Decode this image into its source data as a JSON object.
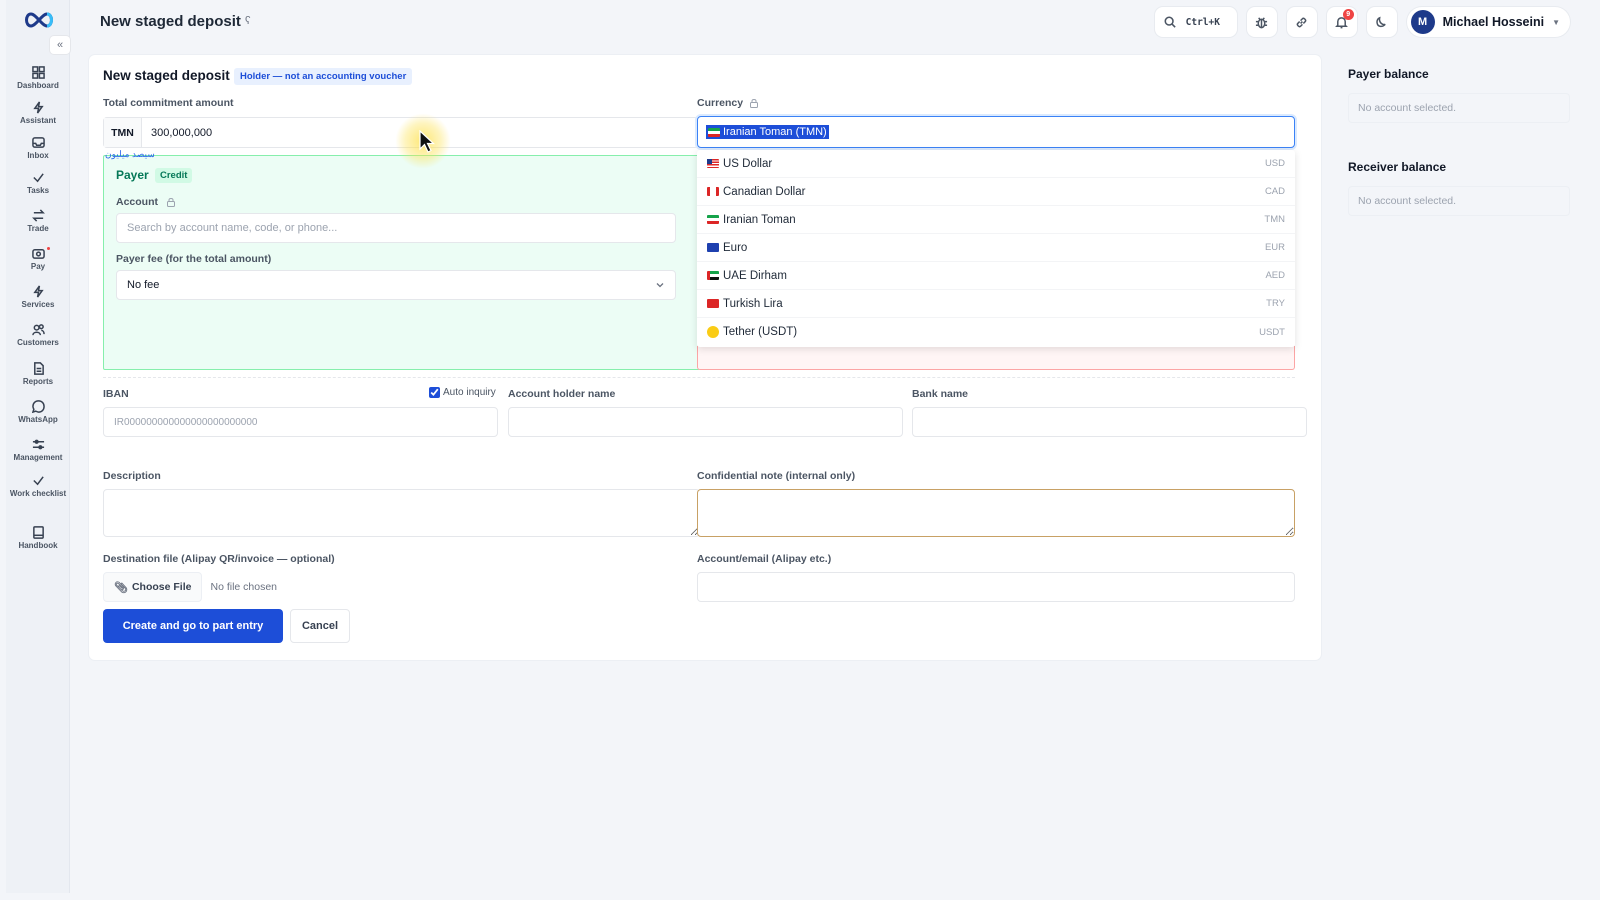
{
  "header": {
    "title": "New staged deposit",
    "search_shortcut": "Ctrl+K",
    "notification_count": "9",
    "user_initial": "M",
    "user_name": "Michael Hosseini"
  },
  "sidebar": {
    "items": [
      {
        "label": "Dashboard",
        "icon": "dashboard-icon"
      },
      {
        "label": "Assistant",
        "icon": "lightning-icon"
      },
      {
        "label": "Inbox",
        "icon": "inbox-icon"
      },
      {
        "label": "Tasks",
        "icon": "check-icon"
      },
      {
        "label": "Trade",
        "icon": "swap-icon"
      },
      {
        "label": "Pay",
        "icon": "camera-icon"
      },
      {
        "label": "Services",
        "icon": "lightning-icon"
      },
      {
        "label": "Customers",
        "icon": "users-icon"
      },
      {
        "label": "Reports",
        "icon": "document-icon"
      },
      {
        "label": "WhatsApp",
        "icon": "chat-icon"
      },
      {
        "label": "Management",
        "icon": "sliders-icon"
      },
      {
        "label": "Work checklist",
        "icon": "check-icon"
      },
      {
        "label": "Handbook",
        "icon": "book-icon"
      }
    ]
  },
  "form": {
    "title": "New staged deposit",
    "holder_tag": "Holder — not an accounting voucher",
    "total_label": "Total commitment amount",
    "amount_prefix": "TMN",
    "amount_value": "300,000,000",
    "amount_words": "سیصد میلیون",
    "currency_label": "Currency",
    "currency_selected": "Iranian Toman (TMN)",
    "payer": {
      "title": "Payer",
      "tag": "Credit",
      "account_label": "Account",
      "account_placeholder": "Search by account name, code, or phone...",
      "fee_label": "Payer fee (for the total amount)",
      "fee_value": "No fee"
    },
    "currency_options": [
      {
        "name": "US Dollar",
        "code": "USD",
        "flag": "us-flag"
      },
      {
        "name": "Canadian Dollar",
        "code": "CAD",
        "flag": "ca-flag"
      },
      {
        "name": "Iranian Toman",
        "code": "TMN",
        "flag": "ir-flag"
      },
      {
        "name": "Euro",
        "code": "EUR",
        "flag": "eu-flag"
      },
      {
        "name": "UAE Dirham",
        "code": "AED",
        "flag": "ae-flag"
      },
      {
        "name": "Turkish Lira",
        "code": "TRY",
        "flag": "tr-flag"
      },
      {
        "name": "Tether (USDT)",
        "code": "USDT",
        "flag": "coin-icon"
      }
    ],
    "iban_label": "IBAN",
    "auto_inquiry_label": "Auto inquiry",
    "iban_placeholder": "IR000000000000000000000000",
    "holder_name_label": "Account holder name",
    "bank_name_label": "Bank name",
    "description_label": "Description",
    "confidential_label": "Confidential note (internal only)",
    "destination_label": "Destination file (Alipay QR/invoice — optional)",
    "choose_file_label": "Choose File",
    "no_file_label": "No file chosen",
    "account_email_label": "Account/email (Alipay etc.)",
    "submit_label": "Create and go to part entry",
    "cancel_label": "Cancel"
  },
  "side": {
    "payer_balance_title": "Payer balance",
    "payer_balance_text": "No account selected.",
    "receiver_balance_title": "Receiver balance",
    "receiver_balance_text": "No account selected."
  },
  "colors": {
    "accent": "#1d4ed8",
    "payer_bg": "#ecfdf5",
    "payer_border": "#86efac",
    "receiver_border": "#fca5a5"
  }
}
